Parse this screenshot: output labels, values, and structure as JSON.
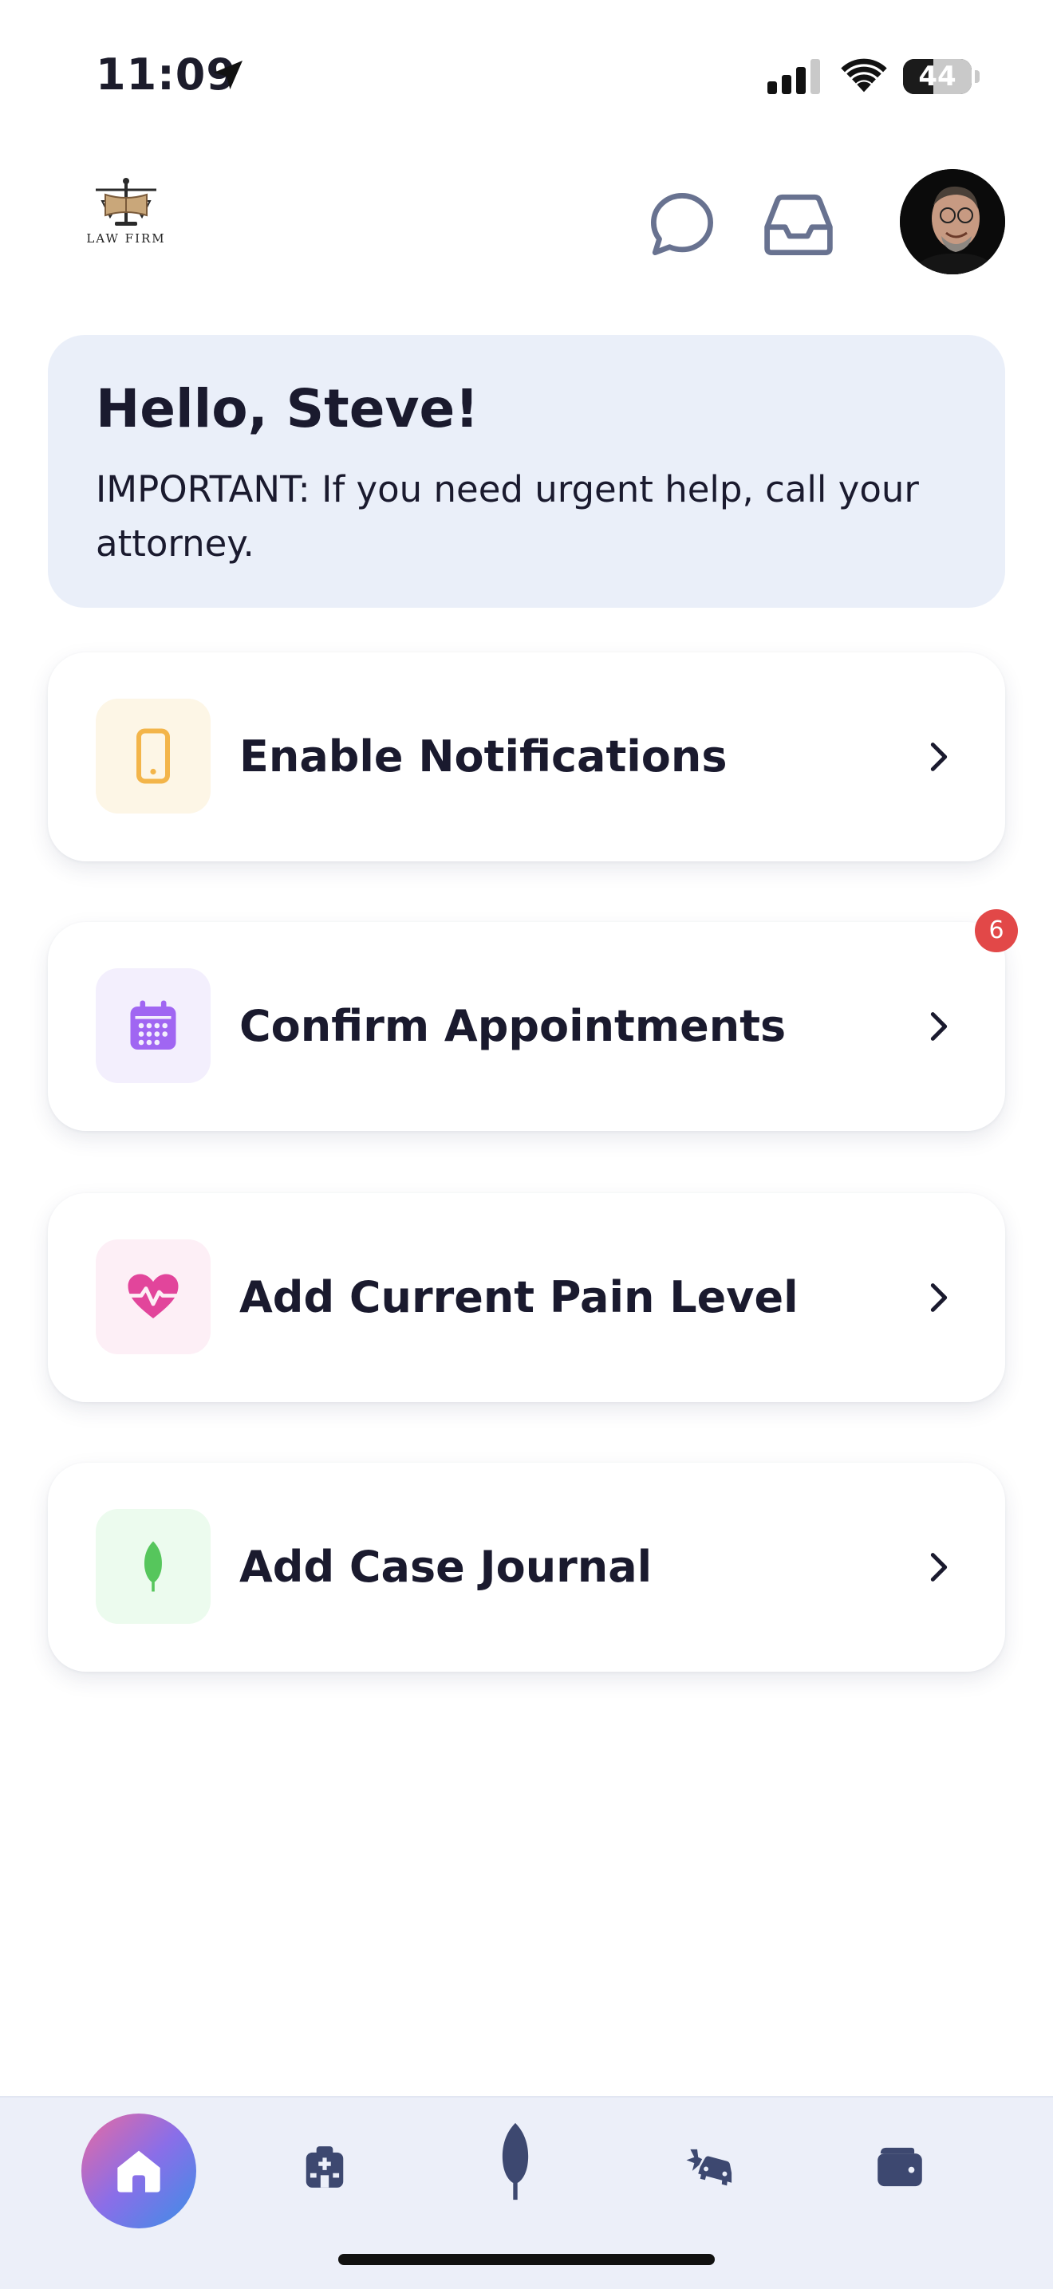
{
  "status_bar": {
    "time": "11:09",
    "battery_level": "44",
    "battery_fraction": 0.44,
    "icons": [
      "location-arrow-icon",
      "cell-signal-icon",
      "wifi-icon",
      "battery-icon"
    ]
  },
  "header": {
    "logo_text": "LAW FIRM",
    "icons": [
      "chat-bubble-icon",
      "inbox-tray-icon"
    ],
    "avatar_alt": "profile photo"
  },
  "greeting": {
    "title": "Hello, Steve!",
    "notice": "IMPORTANT: If you need urgent help, call your attorney."
  },
  "actions": [
    {
      "label": "Enable Notifications",
      "icon": "smartphone-icon",
      "icon_color": "#f3b54a",
      "icon_bg": "#fdf6e6"
    },
    {
      "label": "Confirm Appointments",
      "icon": "calendar-icon",
      "icon_color": "#a066f2",
      "icon_bg": "#f3effd",
      "badge": "6"
    },
    {
      "label": "Add Current Pain Level",
      "icon": "heart-pulse-icon",
      "icon_color": "#e2459b",
      "icon_bg": "#fdeff6"
    },
    {
      "label": "Add Case Journal",
      "icon": "feather-icon",
      "icon_color": "#56c65c",
      "icon_bg": "#ecfbee"
    }
  ],
  "colors": {
    "badge": "#e24848",
    "greeting_bg": "#eaeff9",
    "tab_bar_bg": "#eceff9",
    "tab_icon": "#3d4870"
  },
  "tab_bar": {
    "tabs": [
      "home-icon",
      "hospital-icon",
      "feather-icon",
      "car-crash-icon",
      "wallet-icon"
    ],
    "active": "home-icon"
  }
}
